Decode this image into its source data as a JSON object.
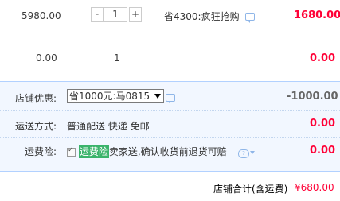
{
  "item1": {
    "unit_price": "5980.00",
    "quantity": "1",
    "minus": "-",
    "plus": "+",
    "discount_text": "省4300:疯狂抢购",
    "subtotal": "1680.00"
  },
  "item2": {
    "unit_price": "0.00",
    "quantity": "1",
    "subtotal": "0.00"
  },
  "shop": {
    "coupon_label": "店铺优惠:",
    "coupon_selected": "省1000元:马0815",
    "coupon_amount": "-1000.00",
    "shipping_label": "运送方式:",
    "shipping_options": "普通配送 快递 免邮",
    "shipping_amount": "0.00",
    "insurance_label": "运费险:",
    "insurance_badge": "运费险",
    "insurance_desc": "卖家送,确认收货前退货可赔",
    "insurance_amount": "0.00"
  },
  "footer": {
    "total_label": "店铺合计(含运费)",
    "total_value": "¥680.00"
  },
  "colors": {
    "price_red": "#ff0036",
    "panel_bg": "#f2f7ff",
    "panel_border": "#b2d1ff",
    "badge_green": "#3bb36b"
  }
}
